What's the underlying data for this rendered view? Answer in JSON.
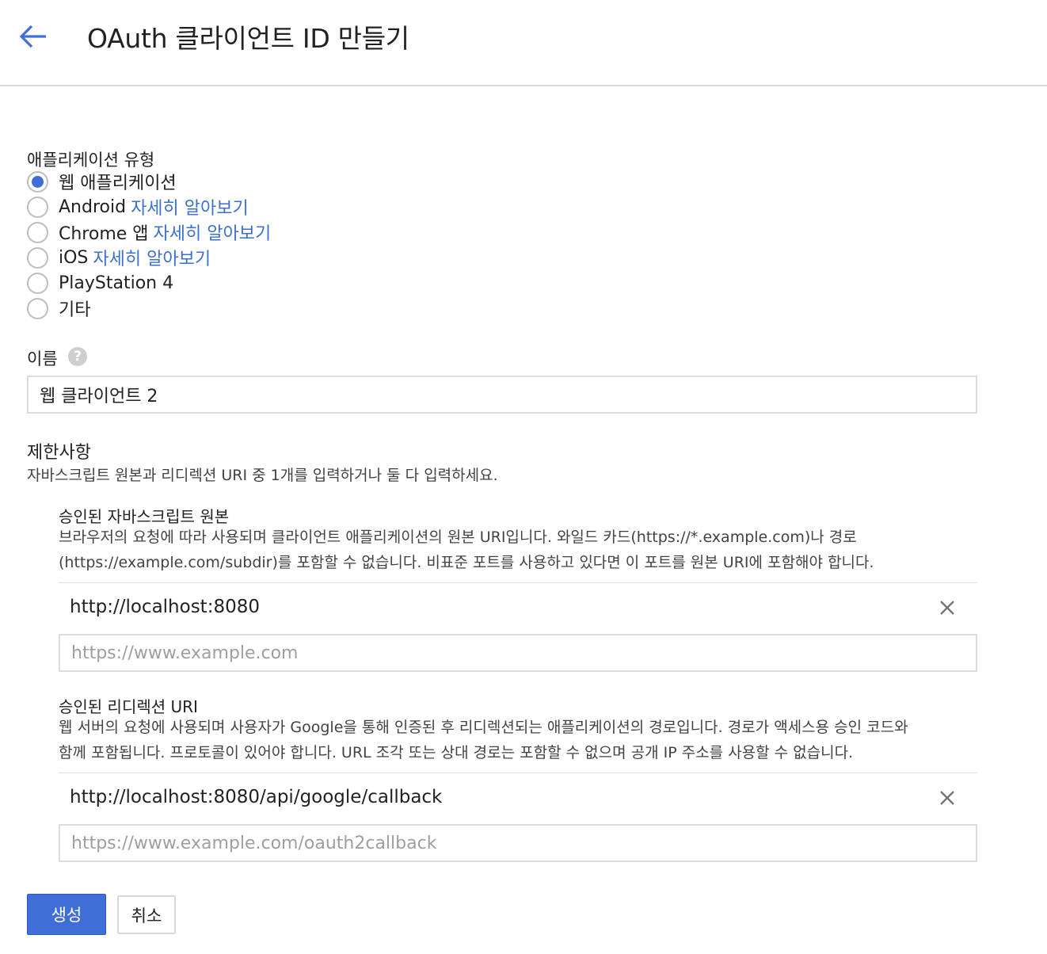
{
  "header": {
    "title": "OAuth 클라이언트 ID 만들기",
    "back_icon": "arrow-left-icon"
  },
  "app_type": {
    "label": "애플리케이션 유형",
    "options": [
      {
        "label": "웹 애플리케이션",
        "link": "",
        "checked": true
      },
      {
        "label": "Android",
        "link": "자세히 알아보기",
        "checked": false
      },
      {
        "label": "Chrome 앱",
        "link": "자세히 알아보기",
        "checked": false
      },
      {
        "label": "iOS",
        "link": "자세히 알아보기",
        "checked": false
      },
      {
        "label": "PlayStation 4",
        "link": "",
        "checked": false
      },
      {
        "label": "기타",
        "link": "",
        "checked": false
      }
    ]
  },
  "name": {
    "label": "이름",
    "help_icon": "question-mark-icon",
    "value": "웹 클라이언트 2"
  },
  "restrictions": {
    "title": "제한사항",
    "description": "자바스크립트 원본과 리디렉션 URI 중 1개를 입력하거나 둘 다 입력하세요.",
    "js_origins": {
      "label": "승인된 자바스크립트 원본",
      "description_line1": "브라우저의 요청에 따라 사용되며 클라이언트 애플리케이션의 원본 URI입니다. 와일드 카드(https://*.example.com)나 경로",
      "description_line2": "(https://example.com/subdir)를 포함할 수 없습니다. 비표준 포트를 사용하고 있다면 이 포트를 원본 URI에 포함해야 합니다.",
      "entries": [
        "http://localhost:8080"
      ],
      "placeholder": "https://www.example.com"
    },
    "redirect_uris": {
      "label": "승인된 리디렉션 URI",
      "description_line1": "웹 서버의 요청에 사용되며 사용자가 Google을 통해 인증된 후 리디렉션되는 애플리케이션의 경로입니다. 경로가 액세스용 승인 코드와",
      "description_line2": "함께 포함됩니다. 프로토콜이 있어야 합니다. URL 조각 또는 상대 경로는 포함할 수 없으며 공개 IP 주소를 사용할 수 없습니다.",
      "entries": [
        "http://localhost:8080/api/google/callback"
      ],
      "placeholder": "https://www.example.com/oauth2callback"
    }
  },
  "actions": {
    "create_label": "생성",
    "cancel_label": "취소"
  },
  "colors": {
    "accent": "#3f6fd6",
    "link": "#3b6fd1"
  }
}
